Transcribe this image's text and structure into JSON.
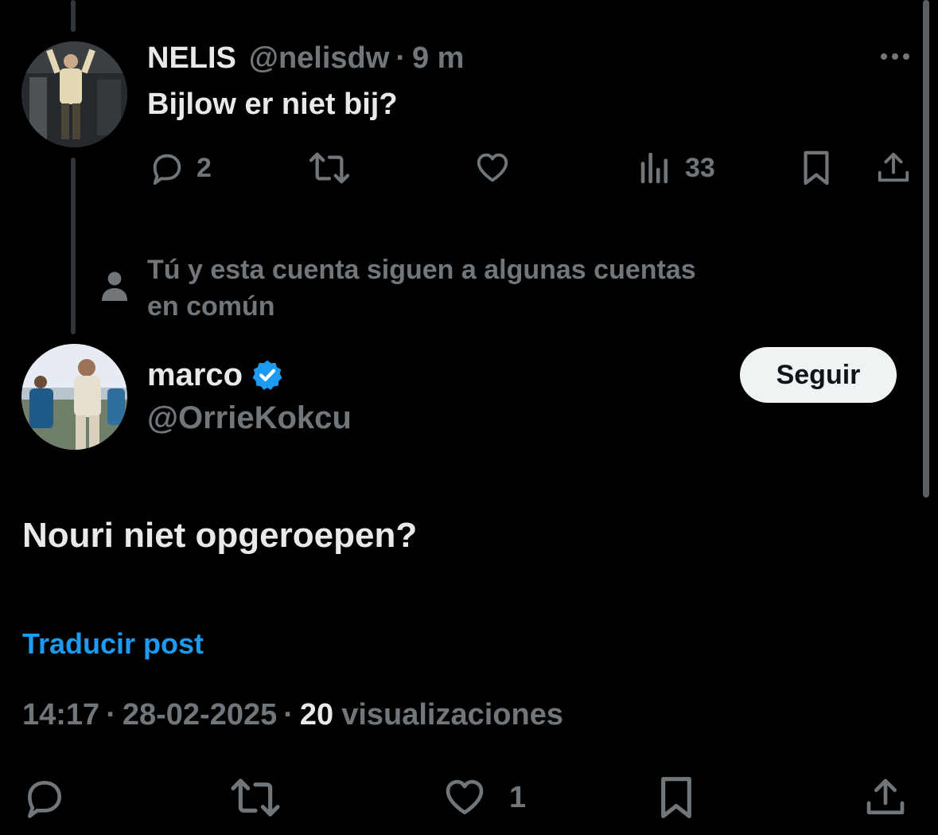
{
  "reply": {
    "display_name": "NELIS",
    "handle": "@nelisdw",
    "separator": "·",
    "time_ago": "9 m",
    "text": "Bijlow er niet bij?",
    "reply_count": "2",
    "views_count": "33",
    "more_icon": "more-horizontal-icon"
  },
  "social_context": {
    "line1": "Tú y esta cuenta siguen a algunas cuentas",
    "line2": "en común",
    "icon": "person-icon"
  },
  "main_post": {
    "display_name": "marco",
    "verified_color": "#1d9bf0",
    "handle": "@OrrieKokcu",
    "follow_label": "Seguir",
    "text": "Nouri niet opgeroepen?",
    "translate_label": "Traducir post",
    "time": "14:17",
    "dot1": "·",
    "date": "28-02-2025",
    "dot2": "·",
    "views_count": "20",
    "views_label": "visualizaciones",
    "like_count": "1"
  },
  "colors": {
    "background": "#000000",
    "text": "#e7e9ea",
    "muted": "#71767b",
    "accent": "#1d9bf0"
  }
}
